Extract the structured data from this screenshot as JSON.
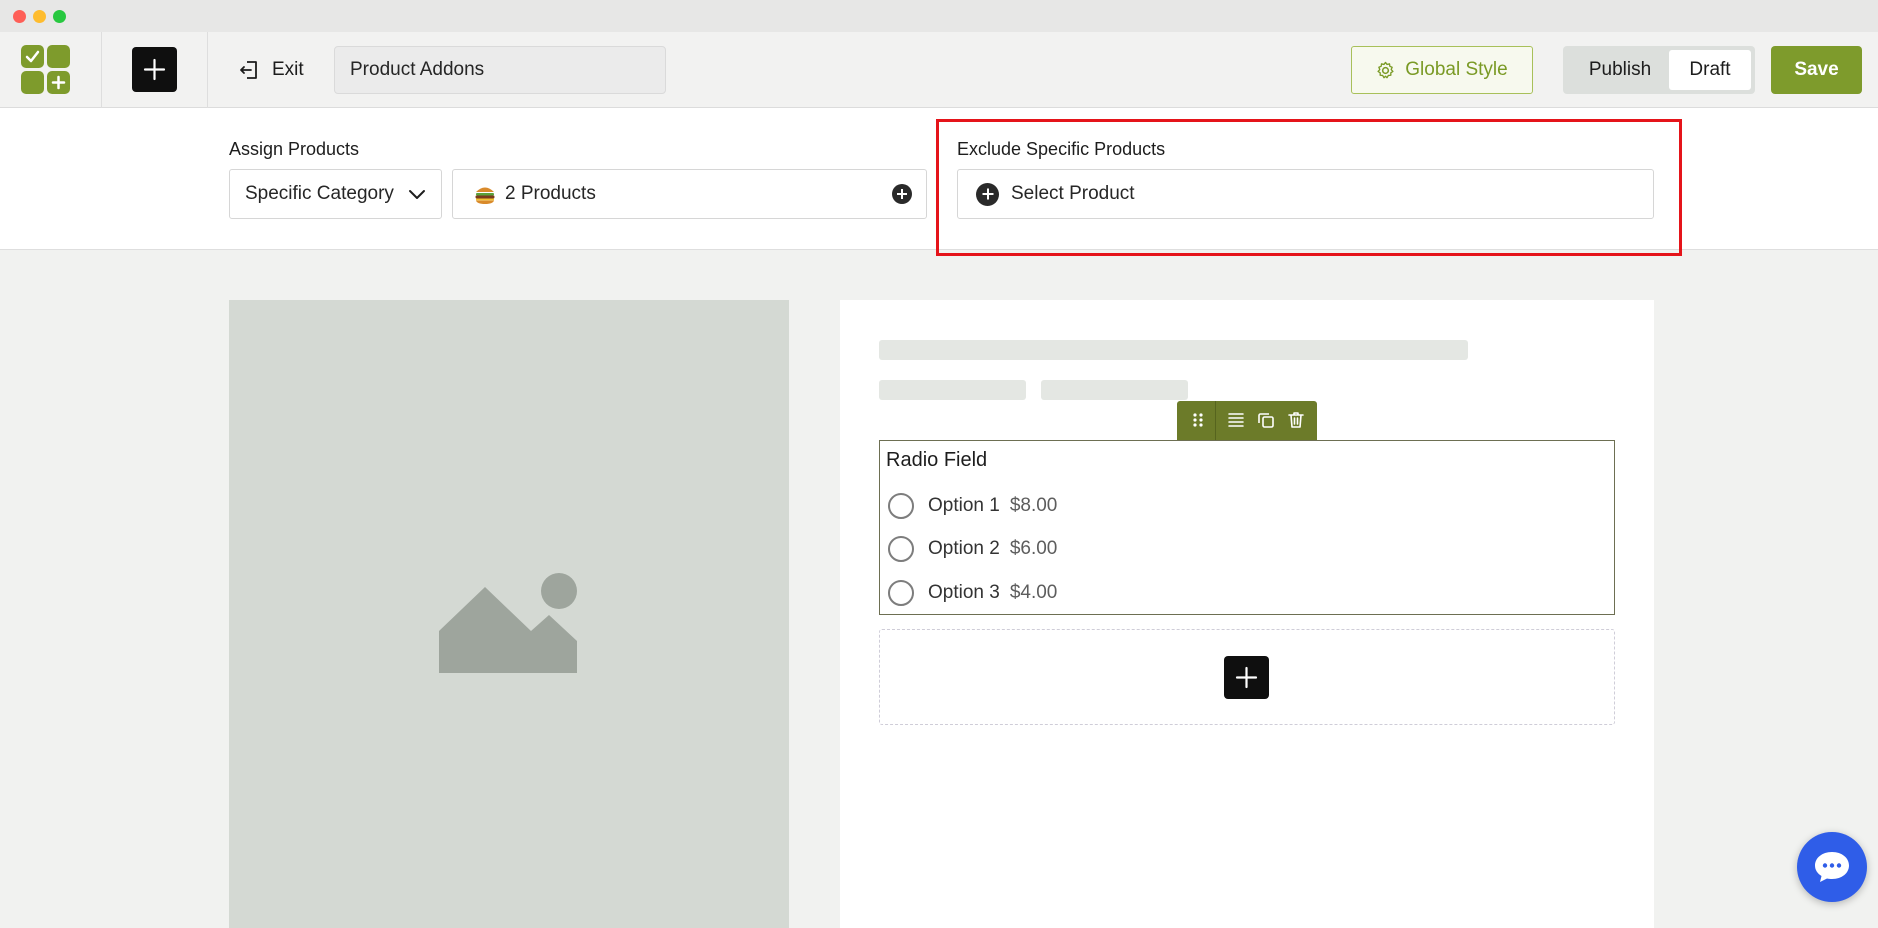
{
  "toolbar": {
    "exit_label": "Exit",
    "addon_name": "Product Addons",
    "global_style_label": "Global Style",
    "publish_label": "Publish",
    "draft_label": "Draft",
    "save_label": "Save"
  },
  "settings": {
    "assign_label": "Assign Products",
    "category_value": "Specific Category",
    "products_count": "2 Products",
    "exclude_label": "Exclude Specific Products",
    "exclude_placeholder": "Select Product"
  },
  "radio_field": {
    "title": "Radio Field",
    "options": [
      {
        "label": "Option 1",
        "price": "$8.00"
      },
      {
        "label": "Option 2",
        "price": "$6.00"
      },
      {
        "label": "Option 3",
        "price": "$4.00"
      }
    ]
  },
  "colors": {
    "brand_green": "#7e9b2c",
    "highlight_red": "#e5141a",
    "chat_blue": "#2f5de8"
  },
  "icons": [
    "plus-icon",
    "exit-icon",
    "gear-icon",
    "chevron-down-icon",
    "burger-icon",
    "drag-handle-icon",
    "align-icon",
    "duplicate-icon",
    "trash-icon",
    "image-placeholder-icon",
    "chat-icon"
  ]
}
